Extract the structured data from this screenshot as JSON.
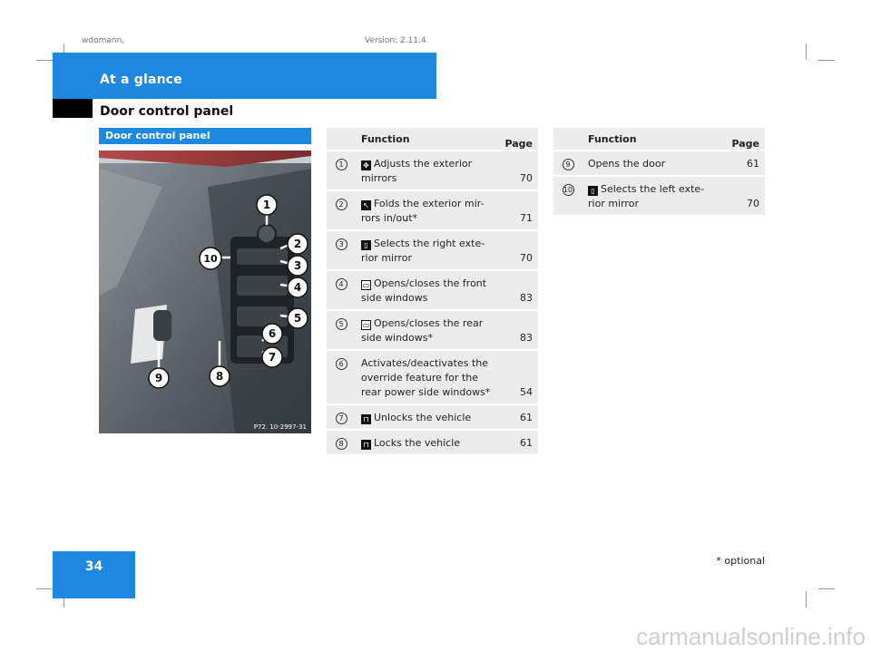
{
  "meta": {
    "author": "wdomann,",
    "version": "Version: 2.11.4"
  },
  "header": {
    "banner_title": "At a glance",
    "section_title": "Door control panel"
  },
  "image_panel": {
    "title": "Door control panel",
    "photo_code": "P72. 10-2997-31",
    "callouts": [
      "1",
      "2",
      "3",
      "4",
      "5",
      "6",
      "7",
      "8",
      "9",
      "10"
    ]
  },
  "table_left": {
    "headers": [
      "",
      "Function",
      "Page"
    ],
    "rows": [
      {
        "num": "1",
        "icon": "mirror-adjust-icon",
        "text": "Adjusts the exterior mirrors",
        "page": "70"
      },
      {
        "num": "2",
        "icon": "mirror-fold-icon",
        "text": "Folds the exterior mir-rors in/out*",
        "page": "71"
      },
      {
        "num": "3",
        "icon": "right-mirror-icon",
        "text": "Selects the right exte-rior mirror",
        "page": "70"
      },
      {
        "num": "4",
        "icon": "window-icon",
        "text": "Opens/closes the front side windows",
        "page": "83"
      },
      {
        "num": "5",
        "icon": "window-icon",
        "text": "Opens/closes the rear side windows*",
        "page": "83"
      },
      {
        "num": "6",
        "icon": "",
        "text": "Activates/deactivates the override feature for the rear power side windows*",
        "page": "54"
      },
      {
        "num": "7",
        "icon": "unlock-icon",
        "text": "Unlocks the vehicle",
        "page": "61"
      },
      {
        "num": "8",
        "icon": "lock-icon",
        "text": "Locks the vehicle",
        "page": "61"
      }
    ]
  },
  "table_right": {
    "headers": [
      "",
      "Function",
      "Page"
    ],
    "rows": [
      {
        "num": "9",
        "icon": "",
        "text": "Opens the door",
        "page": "61"
      },
      {
        "num": "10",
        "icon": "left-mirror-icon",
        "text": "Selects the left exte-rior mirror",
        "page": "70"
      }
    ]
  },
  "page_number": "34",
  "footnote": "* optional",
  "watermark": "carmanualsonline.info"
}
